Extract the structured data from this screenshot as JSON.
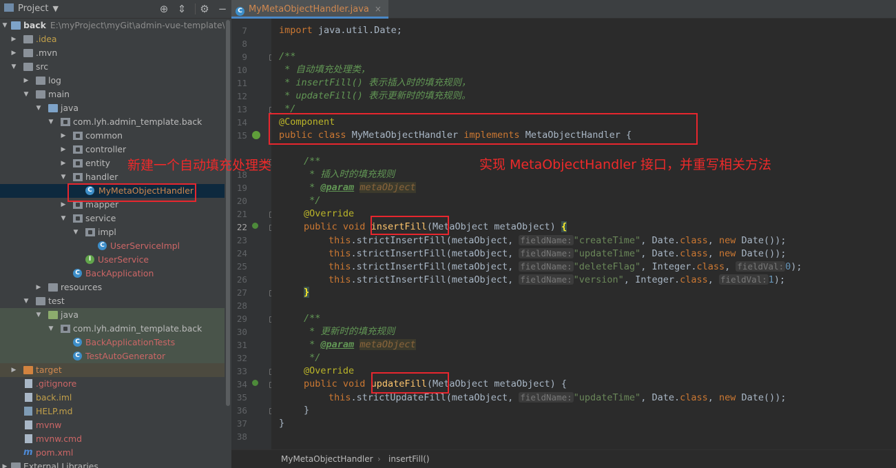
{
  "project_panel": {
    "title": "Project",
    "tree": [
      {
        "label": "back",
        "path": "E:\\myProject\\myGit\\admin-vue-template\\back"
      },
      {
        "label": ".idea"
      },
      {
        "label": ".mvn"
      },
      {
        "label": "src"
      },
      {
        "label": "log"
      },
      {
        "label": "main"
      },
      {
        "label": "java"
      },
      {
        "label": "com.lyh.admin_template.back"
      },
      {
        "label": "common"
      },
      {
        "label": "controller"
      },
      {
        "label": "entity"
      },
      {
        "label": "handler"
      },
      {
        "label": "MyMetaObjectHandler"
      },
      {
        "label": "mapper"
      },
      {
        "label": "service"
      },
      {
        "label": "impl"
      },
      {
        "label": "UserServiceImpl"
      },
      {
        "label": "UserService"
      },
      {
        "label": "BackApplication"
      },
      {
        "label": "resources"
      },
      {
        "label": "test"
      },
      {
        "label": "java"
      },
      {
        "label": "com.lyh.admin_template.back"
      },
      {
        "label": "BackApplicationTests"
      },
      {
        "label": "TestAutoGenerator"
      },
      {
        "label": "target"
      },
      {
        "label": ".gitignore"
      },
      {
        "label": "back.iml"
      },
      {
        "label": "HELP.md"
      },
      {
        "label": "mvnw"
      },
      {
        "label": "mvnw.cmd"
      },
      {
        "label": "pom.xml"
      },
      {
        "label": "External Libraries"
      }
    ]
  },
  "editor": {
    "tab": "MyMetaObjectHandler.java",
    "line_numbers": [
      "7",
      "8",
      "9",
      "10",
      "11",
      "12",
      "13",
      "14",
      "15",
      "",
      "",
      "18",
      "19",
      "20",
      "21",
      "22",
      "23",
      "24",
      "25",
      "26",
      "27",
      "28",
      "29",
      "30",
      "31",
      "32",
      "33",
      "34",
      "35",
      "36",
      "37",
      "38"
    ],
    "code": {
      "l7": {
        "kw": "import",
        "rest": " java.util.Date;"
      },
      "l9": "/**",
      "l10": " * 自动填充处理类，",
      "l11": " * insertFill() 表示插入时的填充规则，",
      "l12": " * updateFill() 表示更新时的填充规则。",
      "l13": " */",
      "l14": "@Component",
      "l15": {
        "kw1": "public",
        "kw2": "class",
        "name": "MyMetaObjectHandler",
        "kw3": "implements",
        "iface": "MetaObjectHandler {"
      },
      "l18": "/**",
      "l19": " * 插入时的填充规则",
      "l20_tag": "@param",
      "l20_val": "metaObject",
      "l21": " */",
      "l22_ann": "@Override",
      "l23": {
        "kw1": "public",
        "kw2": "void",
        "method": "insertFill",
        "params": "(MetaObject metaObject) ",
        "brace": "{"
      },
      "insert_rows": [
        {
          "hint": "fieldName:",
          "str": "\"createTime\"",
          "cls": "Date",
          "tail_kw": "new",
          "tail": " Date());"
        },
        {
          "hint": "fieldName:",
          "str": "\"updateTime\"",
          "cls": "Date",
          "tail_kw": "new",
          "tail": " Date());"
        },
        {
          "hint": "fieldName:",
          "str": "\"deleteFlag\"",
          "cls": "Integer",
          "hint2": "fieldVal:",
          "num": "0",
          "tail": ");"
        },
        {
          "hint": "fieldName:",
          "str": "\"version\"",
          "cls": "Integer",
          "hint2": "fieldVal:",
          "num": "1",
          "tail": ");"
        }
      ],
      "this_kw": "this",
      "strict_insert": "strictInsertFill",
      "strict_update": "strictUpdateFill",
      "arg": "(metaObject, ",
      "class_kw": "class",
      "close_brace_hl": "}",
      "l29": "/**",
      "l30": " * 更新时的填充规则",
      "l32": " */",
      "l33_ann": "@Override",
      "l34": {
        "kw1": "public",
        "kw2": "void",
        "method": "updateFill",
        "params": "(MetaObject metaObject) {"
      },
      "update_row": {
        "hint": "fieldName:",
        "str": "\"updateTime\"",
        "cls": "Date",
        "tail_kw": "new",
        "tail": " Date());"
      },
      "close_method": "}",
      "close_class": "}"
    }
  },
  "annotations": {
    "note_left": "新建一个自动填充处理类",
    "note_right": "实现 MetaObjectHandler 接口，并重写相关方法"
  },
  "breadcrumb": {
    "class": "MyMetaObjectHandler",
    "method": "insertFill()"
  },
  "colors": {
    "annotation_red": "#e8262e",
    "accent_tab": "#4a88c7",
    "keyword": "#cc7832"
  }
}
